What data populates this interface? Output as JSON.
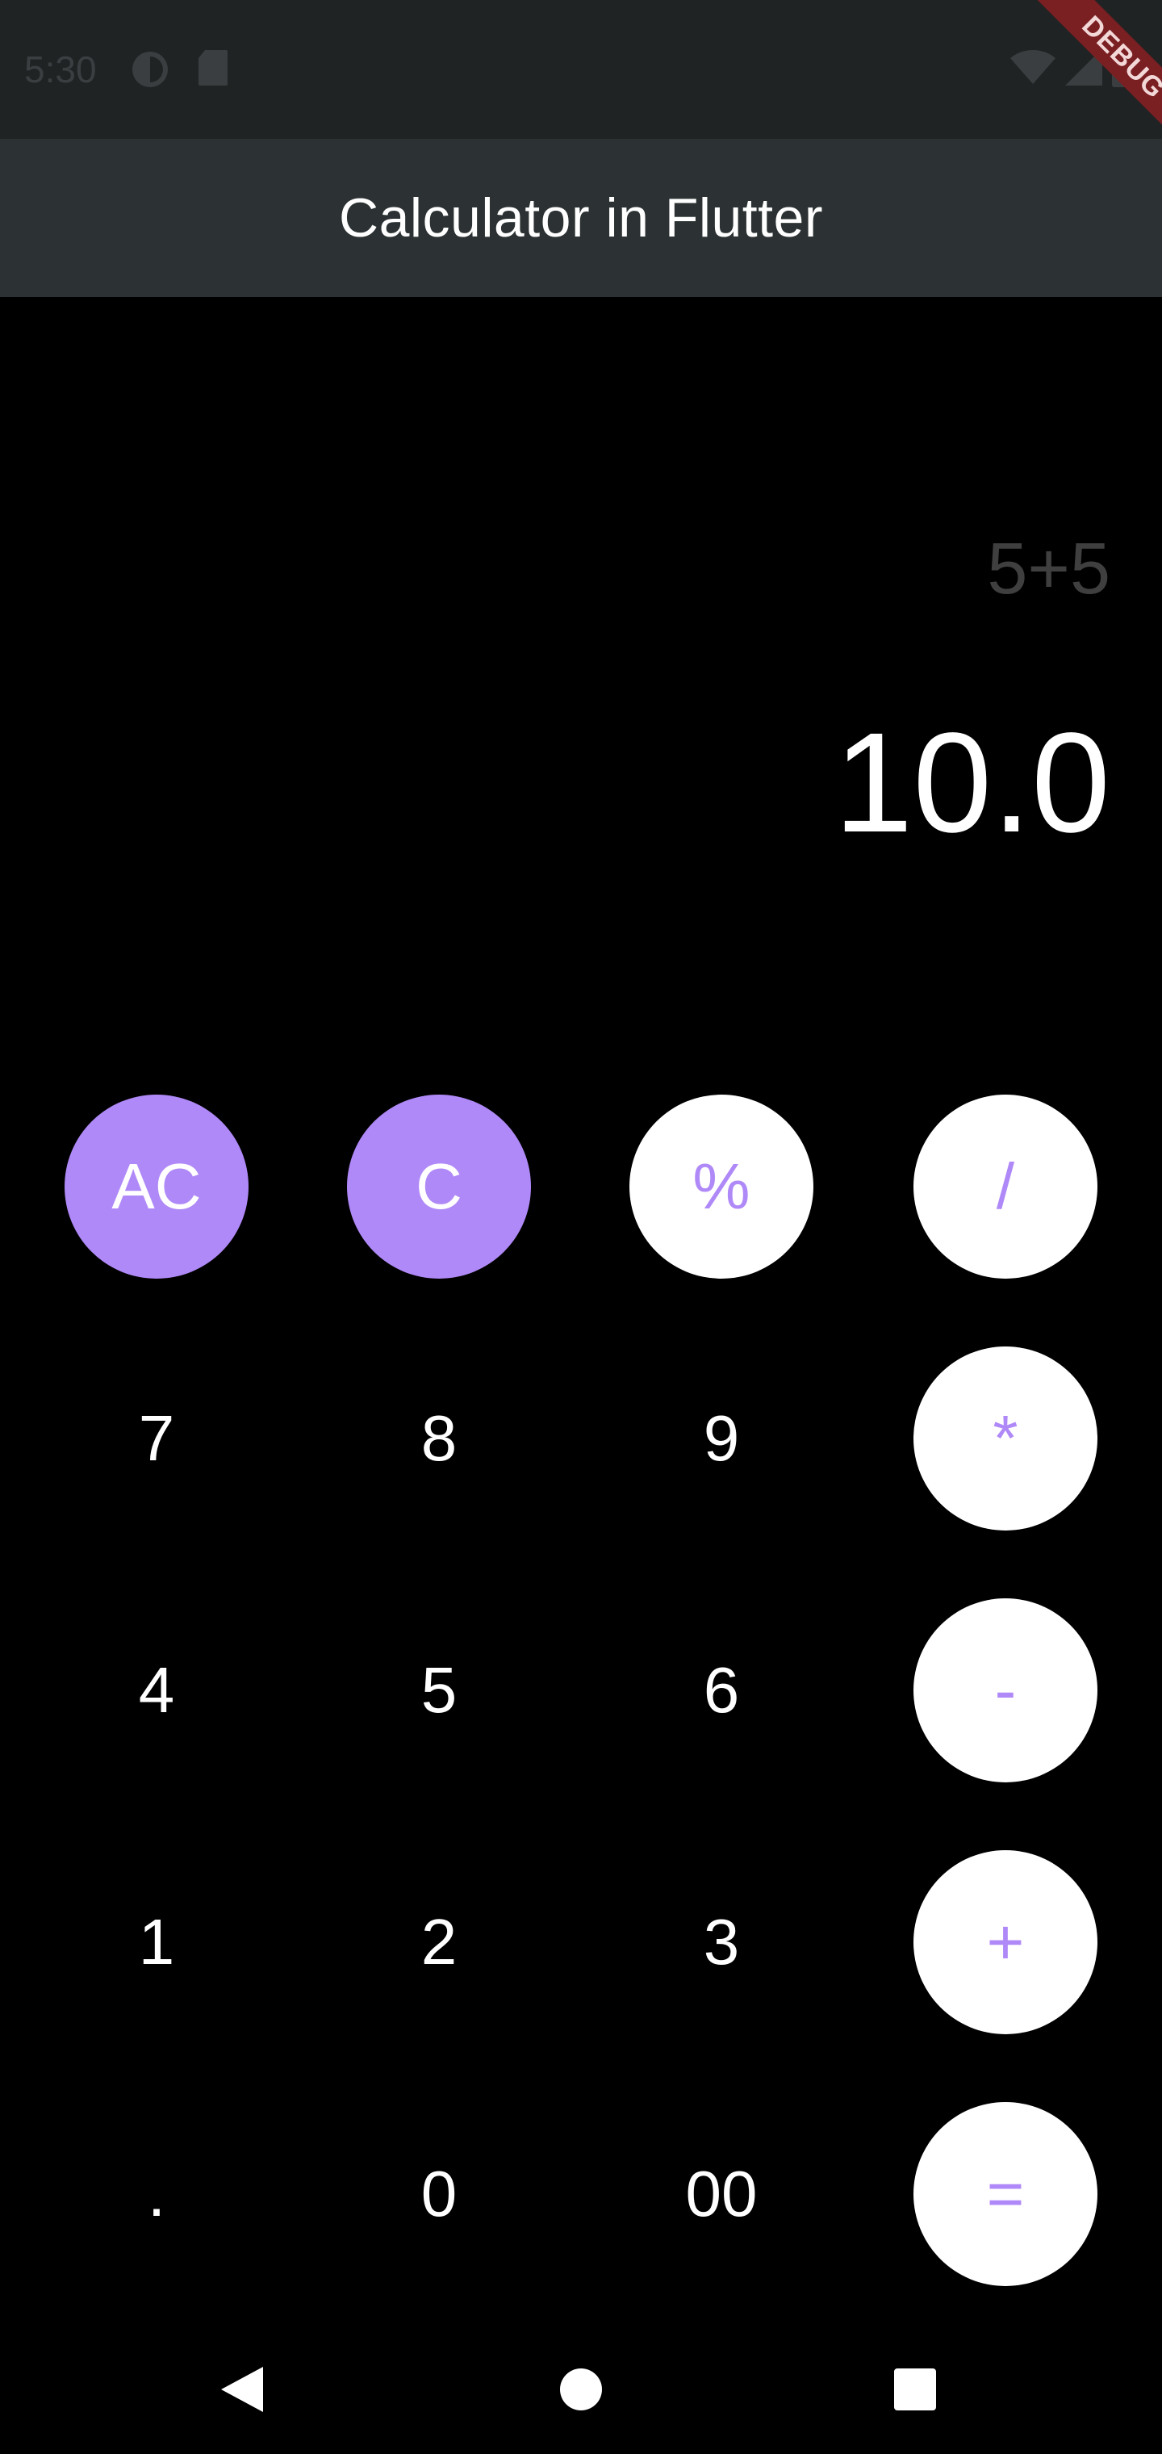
{
  "status_bar": {
    "time": "5:30"
  },
  "app_bar": {
    "title": "Calculator in Flutter"
  },
  "debug_banner": {
    "label": "DEBUG"
  },
  "display": {
    "expression": "5+5",
    "result": "10.0"
  },
  "keypad": {
    "rows": [
      [
        {
          "label": "AC",
          "style": "purple"
        },
        {
          "label": "C",
          "style": "purple"
        },
        {
          "label": "%",
          "style": "white"
        },
        {
          "label": "/",
          "style": "white"
        }
      ],
      [
        {
          "label": "7",
          "style": "plain"
        },
        {
          "label": "8",
          "style": "plain"
        },
        {
          "label": "9",
          "style": "plain"
        },
        {
          "label": "*",
          "style": "white"
        }
      ],
      [
        {
          "label": "4",
          "style": "plain"
        },
        {
          "label": "5",
          "style": "plain"
        },
        {
          "label": "6",
          "style": "plain"
        },
        {
          "label": "-",
          "style": "white"
        }
      ],
      [
        {
          "label": "1",
          "style": "plain"
        },
        {
          "label": "2",
          "style": "plain"
        },
        {
          "label": "3",
          "style": "plain"
        },
        {
          "label": "+",
          "style": "white"
        }
      ],
      [
        {
          "label": ".",
          "style": "plain"
        },
        {
          "label": "0",
          "style": "plain"
        },
        {
          "label": "00",
          "style": "plain"
        },
        {
          "label": "=",
          "style": "white"
        }
      ]
    ]
  },
  "colors": {
    "accent": "#b089f8",
    "background": "#000000",
    "app_bar": "#2c3233",
    "status_bar": "#202324",
    "expression_text": "#3f3f3f"
  },
  "icons": {
    "status_left": [
      "brightness-icon",
      "sd-card-icon"
    ],
    "status_right": [
      "wifi-icon",
      "signal-icon",
      "battery-icon"
    ],
    "nav": [
      "back-icon",
      "home-icon",
      "recents-icon"
    ]
  }
}
